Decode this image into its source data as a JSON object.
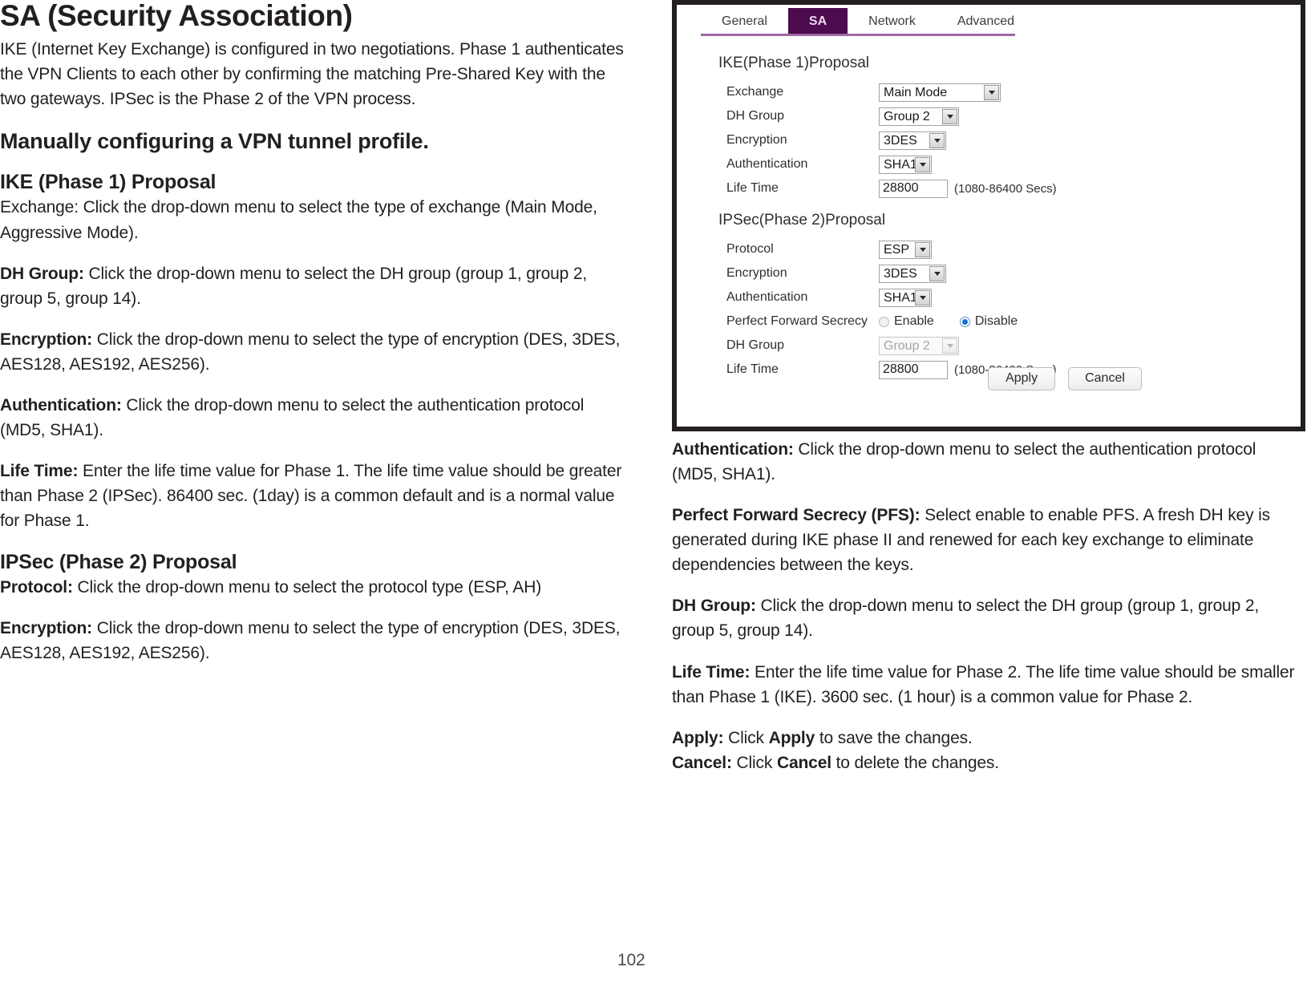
{
  "page": {
    "number": "102"
  },
  "left_column": {
    "title": "SA (Security Association)",
    "intro": "IKE (Internet Key Exchange) is configured in two negotiations. Phase 1 authenticates the VPN Clients to each other by confirming the matching Pre-Shared Key with the two gateways. IPSec is the Phase 2 of the VPN process.",
    "manual_heading": "Manually configuring a VPN tunnel profile.",
    "ike_heading": "IKE (Phase 1) Proposal",
    "exchange_para": "Exchange: Click the drop-down menu to select the type of exchange (Main Mode, Aggressive Mode).",
    "dh_group_label": "DH Group:",
    "dh_group_text": " Click the drop-down menu to select the DH group (group 1, group 2, group 5, group 14).",
    "encryption_label": "Encryption:",
    "encryption_text": " Click the drop-down menu to select the type of encryption (DES, 3DES, AES128, AES192, AES256).",
    "authentication_label": "Authentication:",
    "authentication_text": " Click the drop-down menu to select the authentication protocol (MD5, SHA1).",
    "life_time_label": "Life Time:",
    "life_time_text": " Enter the life time value for Phase 1. The life time value should be greater than Phase 2 (IPSec). 86400 sec. (1day) is a common default and is a normal value for Phase 1.",
    "ipsec_heading": "IPSec (Phase 2) Proposal",
    "protocol_label": "Protocol:",
    "protocol_text": " Click the drop-down menu to select the protocol type (ESP, AH)",
    "encryption2_label": "Encryption:",
    "encryption2_text": " Click the drop-down menu to select the type of encryption (DES, 3DES, AES128, AES192, AES256)."
  },
  "right_column": {
    "authentication_label": "Authentication:",
    "authentication_text": " Click the drop-down menu to select the authentication protocol (MD5, SHA1).",
    "pfs_label": "Perfect Forward Secrecy (PFS):",
    "pfs_text": " Select enable to enable PFS. A fresh DH key is generated during IKE phase II and renewed for each key exchange to eliminate dependencies between the keys.",
    "dh_group_label": "DH Group:",
    "dh_group_text": " Click the drop-down menu to select the DH group (group 1, group 2, group 5, group 14).",
    "life_time_label": "Life Time:",
    "life_time_text": " Enter the life time value for Phase 2. The life time value should be smaller than Phase 1 (IKE). 3600 sec. (1 hour) is a common value for Phase 2.",
    "apply_label": "Apply:",
    "apply_text_pre": " Click ",
    "apply_bold": "Apply",
    "apply_text_post": " to save the changes.",
    "cancel_label": "Cancel:",
    "cancel_text_pre": " Click ",
    "cancel_bold": "Cancel",
    "cancel_text_post": " to delete the changes."
  },
  "router_panel": {
    "accent_active_bg": "#4b0b4c",
    "accent_underline": "#9e6aa4",
    "tabs": [
      {
        "label": "General",
        "active": false
      },
      {
        "label": "SA",
        "active": true
      },
      {
        "label": "Network",
        "active": false
      },
      {
        "label": "Advanced",
        "active": false
      }
    ],
    "phase1": {
      "group_title": "IKE(Phase 1)Proposal",
      "exchange": {
        "label": "Exchange",
        "value": "Main Mode"
      },
      "dh_group": {
        "label": "DH Group",
        "value": "Group 2"
      },
      "encryption": {
        "label": "Encryption",
        "value": "3DES"
      },
      "authentication": {
        "label": "Authentication",
        "value": "SHA1"
      },
      "life_time": {
        "label": "Life Time",
        "value": "28800",
        "hint": "(1080-86400 Secs)"
      }
    },
    "phase2": {
      "group_title": "IPSec(Phase 2)Proposal",
      "protocol": {
        "label": "Protocol",
        "value": "ESP"
      },
      "encryption": {
        "label": "Encryption",
        "value": "3DES"
      },
      "authentication": {
        "label": "Authentication",
        "value": "SHA1"
      },
      "pfs": {
        "label": "Perfect Forward Secrecy",
        "enable_label": "Enable",
        "disable_label": "Disable",
        "selected": "Disable"
      },
      "dh_group": {
        "label": "DH Group",
        "value": "Group 2",
        "disabled": true
      },
      "life_time": {
        "label": "Life Time",
        "value": "28800",
        "hint": "(1080-86400 Secs)"
      }
    },
    "buttons": {
      "apply": "Apply",
      "cancel": "Cancel"
    }
  }
}
